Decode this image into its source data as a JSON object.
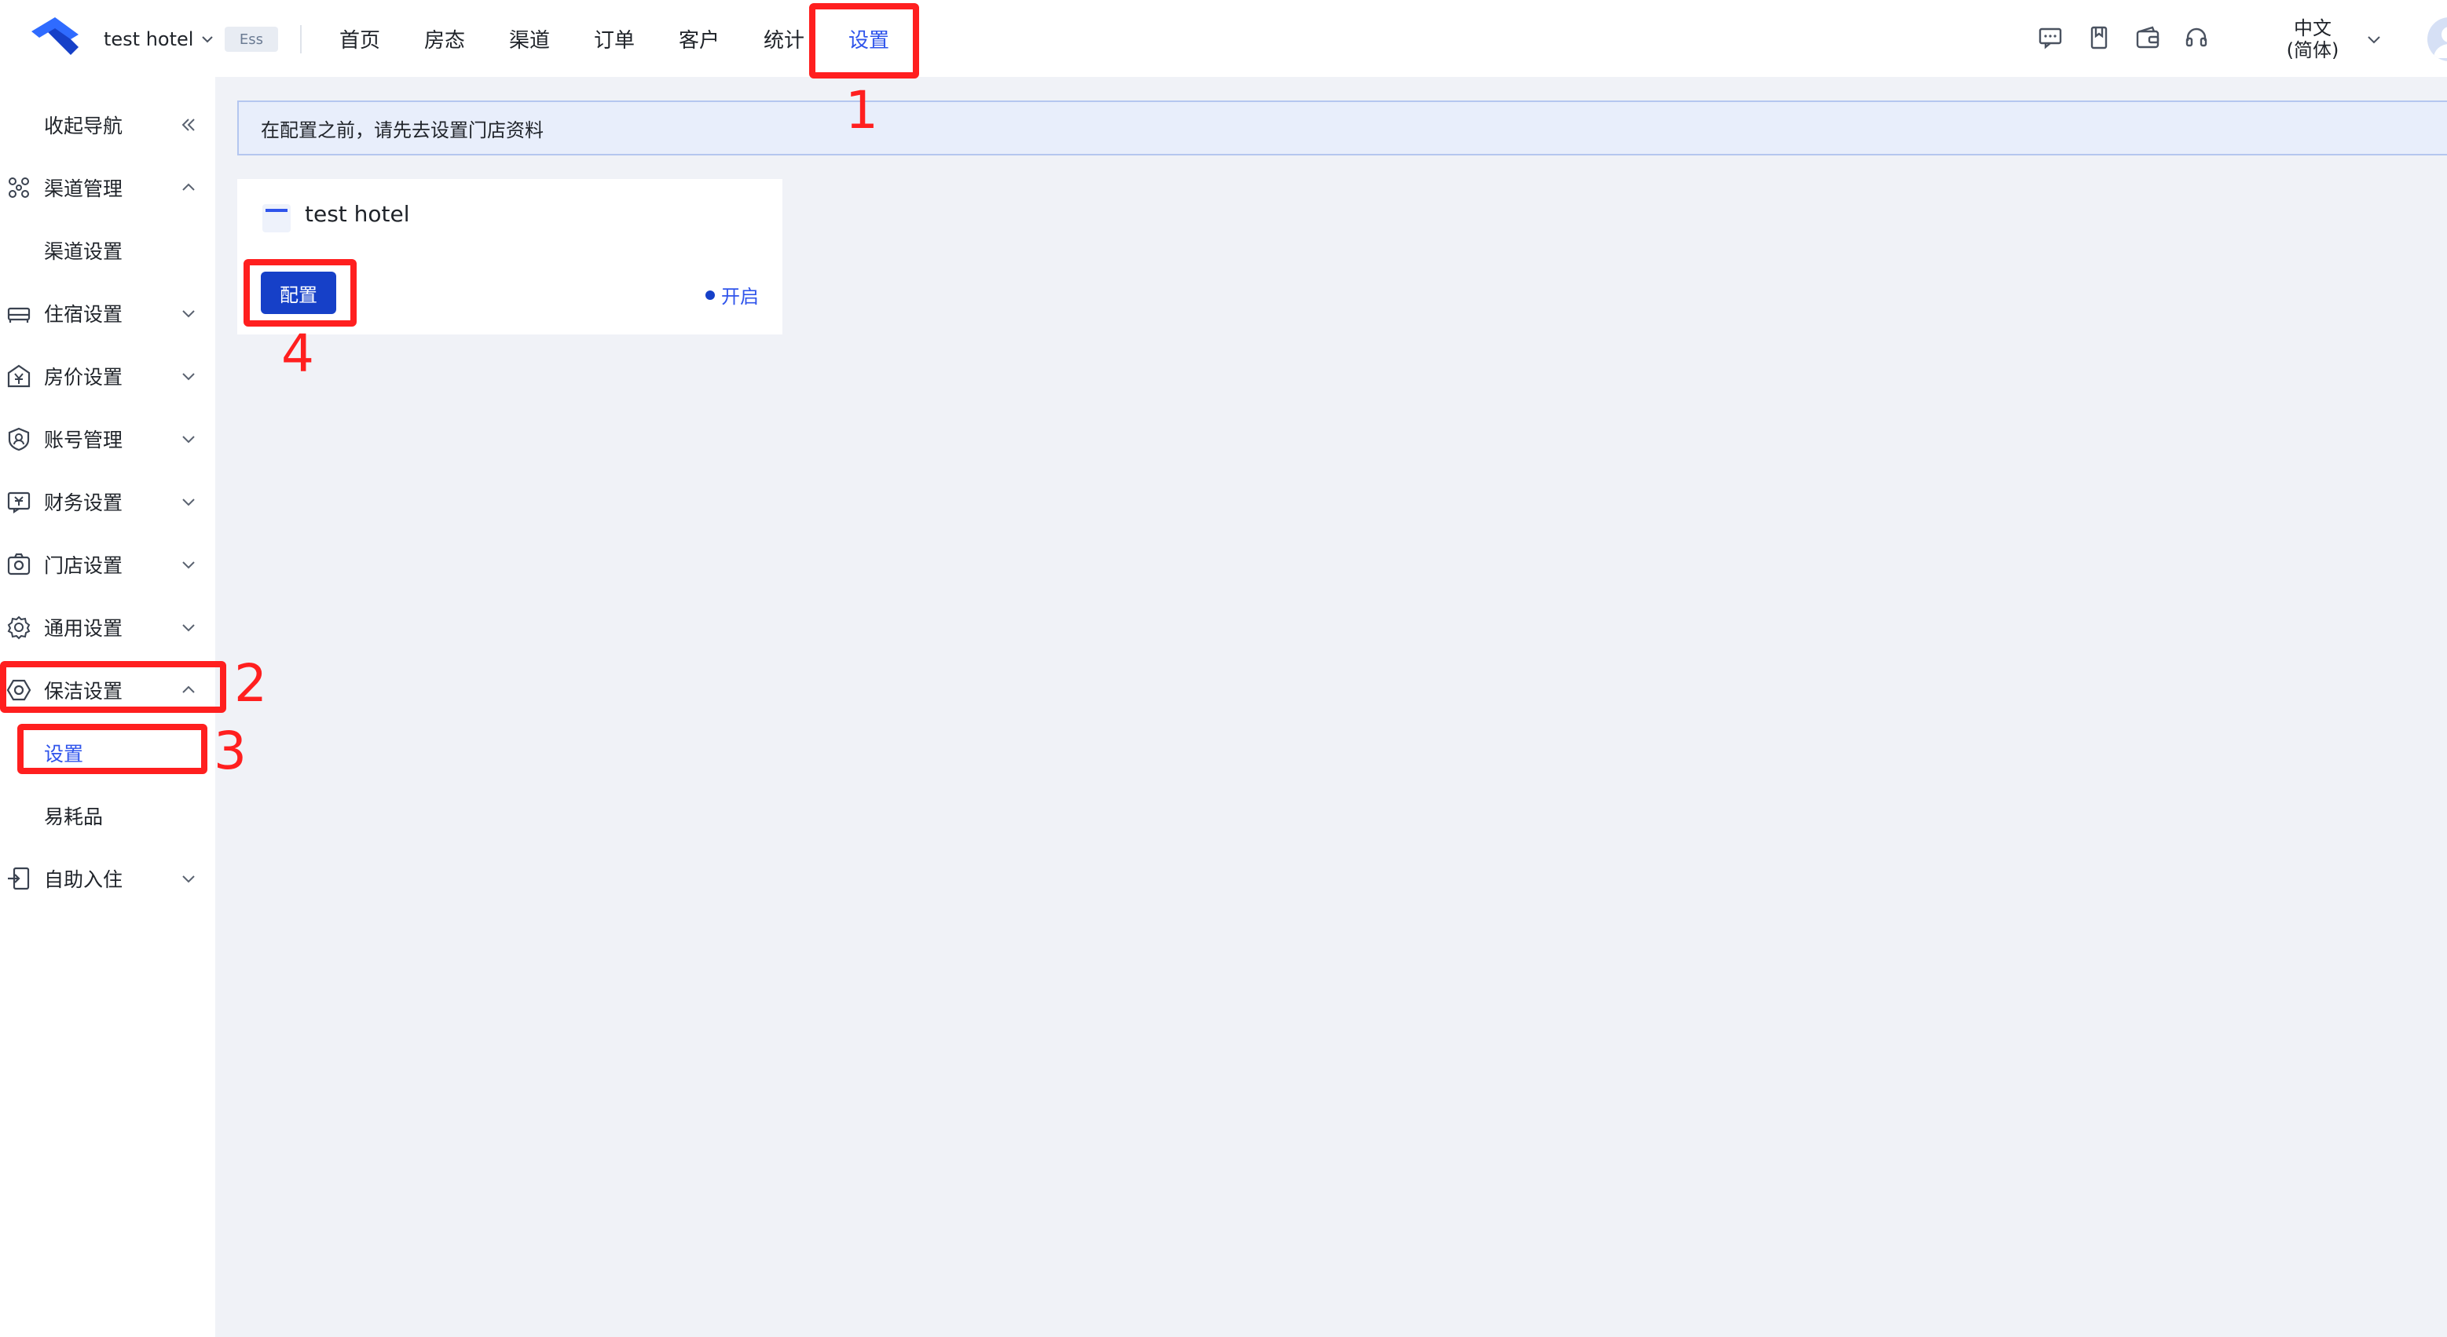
{
  "header": {
    "hotel_name": "test hotel",
    "tag": "Ess",
    "nav": [
      "首页",
      "房态",
      "渠道",
      "订单",
      "客户",
      "统计",
      "设置"
    ],
    "active_nav": "设置",
    "language_line1": "中文",
    "language_line2": "(简体)"
  },
  "sidebar": {
    "collapse_label": "收起导航",
    "items": [
      {
        "label": "渠道管理",
        "icon": "channel-icon",
        "expanded": true
      },
      {
        "label": "渠道设置",
        "sub": true
      },
      {
        "label": "住宿设置",
        "icon": "bed-icon"
      },
      {
        "label": "房价设置",
        "icon": "price-icon"
      },
      {
        "label": "账号管理",
        "icon": "account-icon"
      },
      {
        "label": "财务设置",
        "icon": "finance-icon"
      },
      {
        "label": "门店设置",
        "icon": "store-icon"
      },
      {
        "label": "通用设置",
        "icon": "gear-icon"
      },
      {
        "label": "保洁设置",
        "icon": "cleaning-icon",
        "expanded": true
      },
      {
        "label": "设置",
        "sub": true,
        "selected": true
      },
      {
        "label": "易耗品",
        "sub": true
      },
      {
        "label": "自助入住",
        "icon": "checkin-icon"
      }
    ]
  },
  "alert": {
    "text": "在配置之前，请先去设置门店资料"
  },
  "card": {
    "title": "test hotel",
    "button": "配置",
    "status": "开启"
  },
  "annotations": [
    "1",
    "2",
    "3",
    "4"
  ],
  "colors": {
    "accent": "#2f54eb",
    "button": "#1640c8",
    "annotation": "#ff1f1f"
  }
}
